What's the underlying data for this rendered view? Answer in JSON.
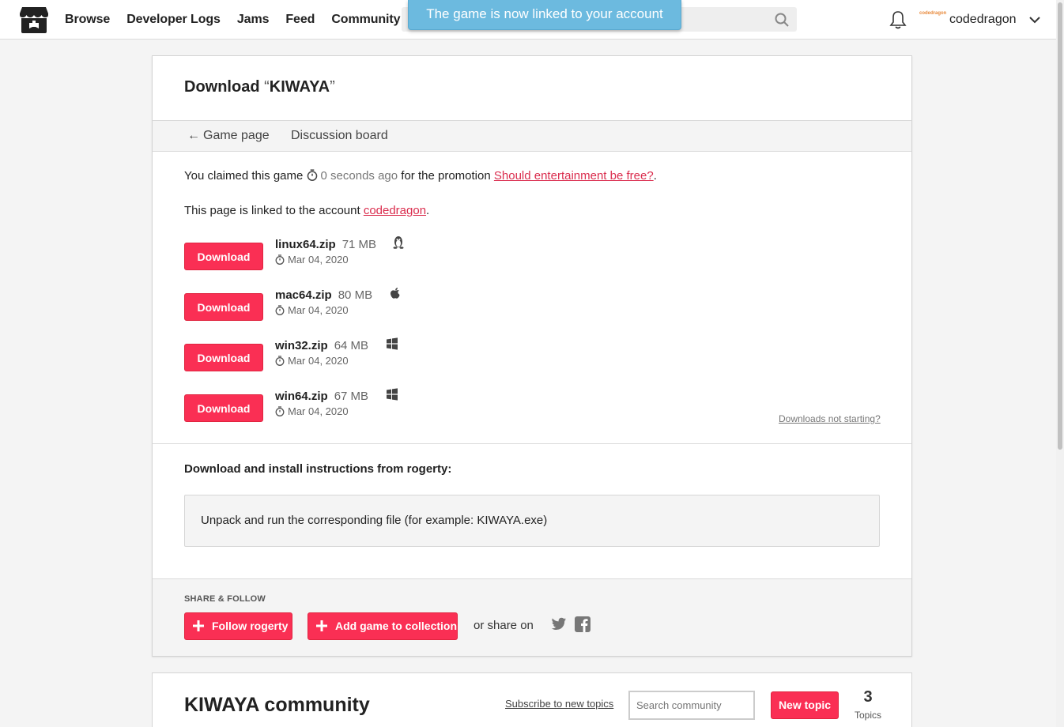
{
  "header": {
    "nav": [
      "Browse",
      "Developer Logs",
      "Jams",
      "Feed",
      "Community"
    ],
    "toast": "The game is now linked to your account",
    "avatar_text": "codedragon",
    "username": "codedragon"
  },
  "page": {
    "title_prefix": "Download ",
    "title_open_quote": "“",
    "title_game": "KIWAYA",
    "title_close_quote": "”",
    "tabs": {
      "back": "Game page",
      "discussion": "Discussion board"
    },
    "claim_text": "You claimed this game",
    "claim_time": "0 seconds ago",
    "claim_mid": "for the promotion",
    "promotion_link": "Should entertainment be free?",
    "claim_end": ".",
    "linked_text": "This page is linked to the account",
    "linked_account": "codedragon",
    "linked_end": "."
  },
  "downloads": [
    {
      "button": "Download",
      "file": "linux64.zip",
      "size": "71 MB",
      "platform_icon": "linux-icon",
      "date": "Mar 04, 2020"
    },
    {
      "button": "Download",
      "file": "mac64.zip",
      "size": "80 MB",
      "platform_icon": "apple-icon",
      "date": "Mar 04, 2020"
    },
    {
      "button": "Download",
      "file": "win32.zip",
      "size": "64 MB",
      "platform_icon": "windows-icon",
      "date": "Mar 04, 2020"
    },
    {
      "button": "Download",
      "file": "win64.zip",
      "size": "67 MB",
      "platform_icon": "windows-icon",
      "date": "Mar 04, 2020"
    }
  ],
  "not_starting": "Downloads not starting?",
  "instructions": {
    "title": "Download and install instructions from rogerty:",
    "body": "Unpack and run the corresponding file (for example: KIWAYA.exe)"
  },
  "share": {
    "label": "SHARE & FOLLOW",
    "follow": "Follow rogerty",
    "collection": "Add game to collection",
    "or_share": "or share on"
  },
  "community": {
    "title": "KIWAYA community",
    "subscribe": "Subscribe to new topics",
    "search_placeholder": "Search community",
    "new_topic": "New topic",
    "topics_count": "3",
    "topics_label": "Topics"
  },
  "colors": {
    "accent": "#fa2f54",
    "link": "#da2c4d",
    "toast": "#6cbadf"
  }
}
